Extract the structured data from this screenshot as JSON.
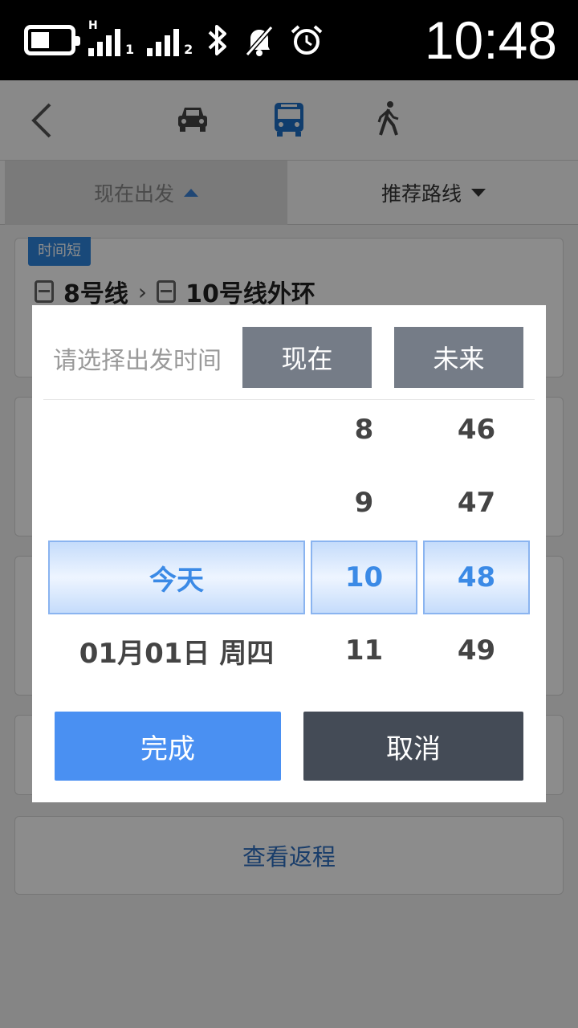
{
  "status_bar": {
    "time": "10:48",
    "icons": [
      "battery-icon",
      "signal-sim1-icon",
      "signal-sim2-icon",
      "bluetooth-icon",
      "mute-icon",
      "alarm-icon"
    ],
    "sim1": "1",
    "sim2": "2",
    "net": "H"
  },
  "toolbar": {
    "modes": [
      "car-icon",
      "bus-icon",
      "walk-icon"
    ],
    "active_mode": "bus",
    "accent": "#1e6fc6"
  },
  "tabs": {
    "depart_label": "现在出发",
    "sort_label": "推荐路线"
  },
  "route_card": {
    "badge": "时间短",
    "line1": "8号线",
    "line2": "10号线外环"
  },
  "return_link": "查看返程",
  "dialog": {
    "title": "请选择出发时间",
    "now_label": "现在",
    "future_label": "未来",
    "date_column": [
      "",
      "",
      "今天",
      "01月01日 周四"
    ],
    "hour_column": [
      "8",
      "9",
      "10",
      "11"
    ],
    "minute_column": [
      "46",
      "47",
      "48",
      "49"
    ],
    "done_label": "完成",
    "cancel_label": "取消",
    "colors": {
      "primary_button": "#4a90f2",
      "secondary_button": "#444b56",
      "selected_text": "#3b8ae6",
      "option_button": "#757c87"
    }
  }
}
